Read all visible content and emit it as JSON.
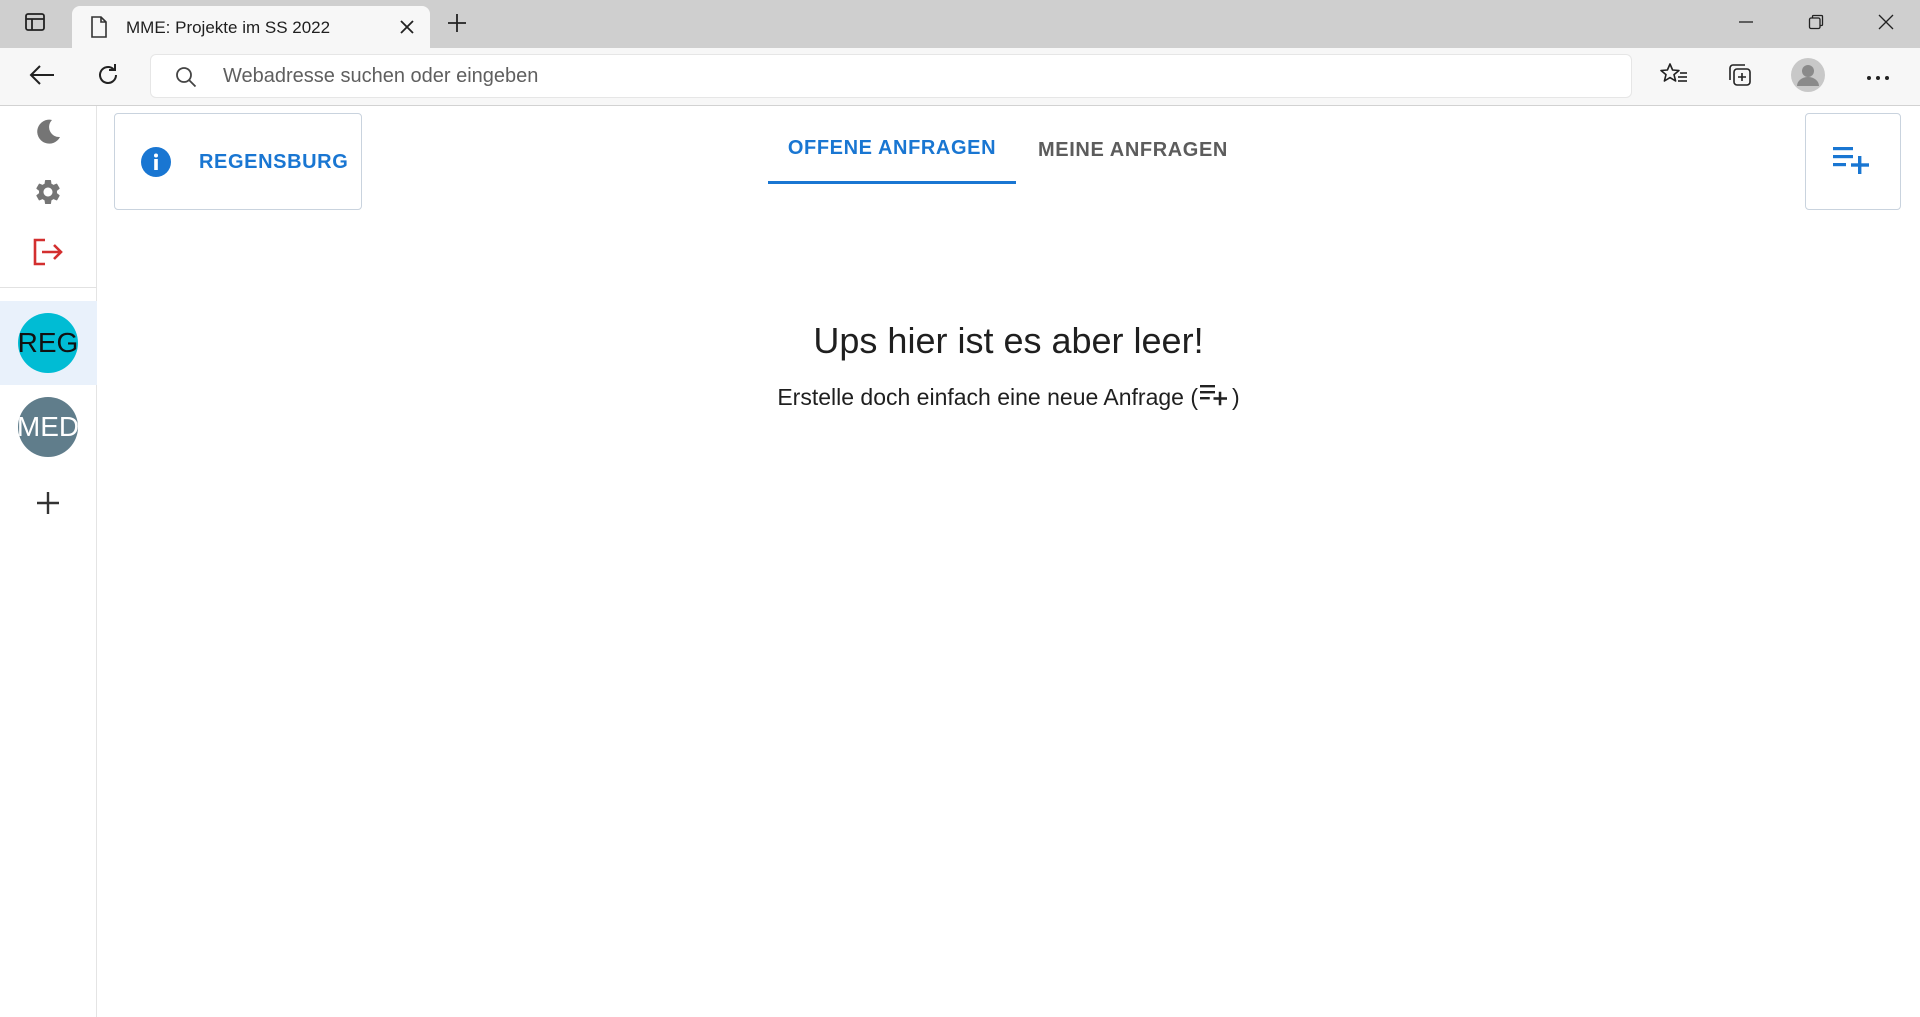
{
  "browser": {
    "tab_title": "MME: Projekte im SS 2022",
    "address_placeholder": "Webadresse suchen oder eingeben"
  },
  "sidebar": {
    "items": [
      {
        "icon": "moon-icon"
      },
      {
        "icon": "gear-icon"
      },
      {
        "icon": "logout-icon",
        "color": "#d32f2f"
      }
    ],
    "groups": [
      {
        "label": "REG",
        "color": "#00bcd4",
        "selected": true
      },
      {
        "label": "MED",
        "color": "#607d8b",
        "selected": false
      }
    ],
    "add_icon": "plus-icon"
  },
  "header": {
    "location": "REGENSBURG",
    "tabs": [
      {
        "label": "OFFENE ANFRAGEN",
        "active": true
      },
      {
        "label": "MEINE ANFRAGEN",
        "active": false
      }
    ]
  },
  "empty_state": {
    "title": "Ups hier ist es aber leer!",
    "subtitle_before": "Erstelle doch einfach eine neue Anfrage (",
    "subtitle_after": ")"
  },
  "colors": {
    "accent": "#1976d2",
    "danger": "#d32f2f"
  }
}
